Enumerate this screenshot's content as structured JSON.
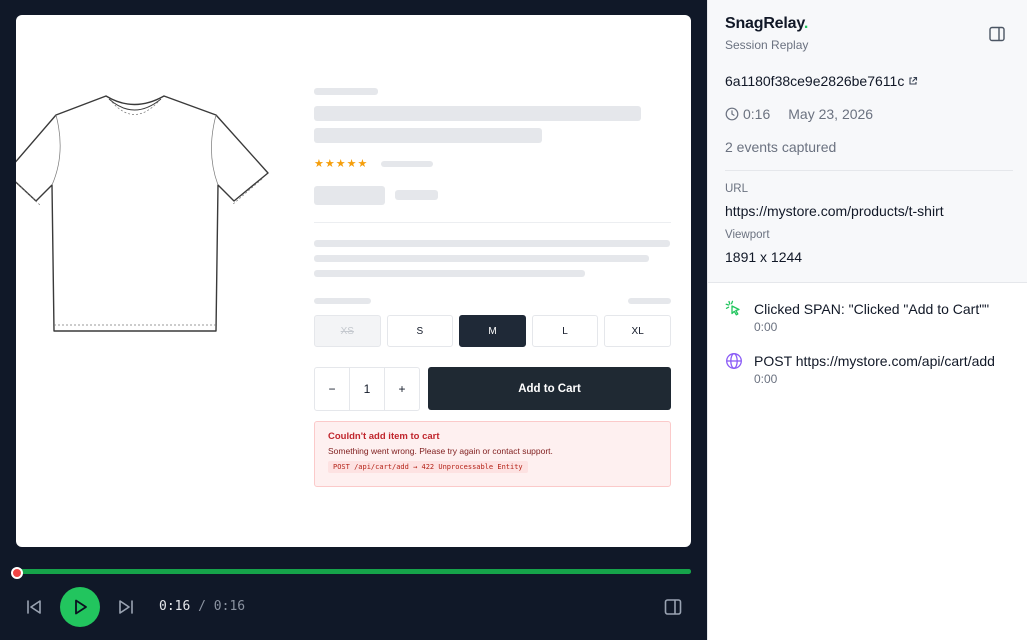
{
  "product_page": {
    "sizes": [
      {
        "label": "XS",
        "state": "disabled"
      },
      {
        "label": "S",
        "state": "normal"
      },
      {
        "label": "M",
        "state": "selected"
      },
      {
        "label": "L",
        "state": "normal"
      },
      {
        "label": "XL",
        "state": "normal"
      }
    ],
    "rating_stars": "★★★★★",
    "quantity": {
      "minus": "−",
      "value": "1",
      "plus": "+"
    },
    "add_to_cart_label": "Add to Cart",
    "error": {
      "title": "Couldn't add item to cart",
      "message": "Something went wrong. Please try again or contact support.",
      "code": "POST /api/cart/add → 422 Unprocessable Entity"
    }
  },
  "player": {
    "current_time": "0:16",
    "separator": "/",
    "total_time": "0:16",
    "progress_fraction": 1.0
  },
  "sidebar": {
    "brand": "SnagRelay",
    "brand_dot": ".",
    "subtitle": "Session Replay",
    "session_id": "6a1180f38ce9e2826be7611c",
    "duration": "0:16",
    "date": "May 23, 2026",
    "events_count": "2 events captured",
    "url_label": "URL",
    "url_value": "https://mystore.com/products/t-shirt",
    "viewport_label": "Viewport",
    "viewport_value": "1891 x 1244",
    "events": [
      {
        "type": "click",
        "icon": "cursor-click-icon",
        "title": "Clicked SPAN: \"Clicked \"Add to Cart\"\"",
        "time": "0:00"
      },
      {
        "type": "network",
        "icon": "globe-icon",
        "title": "POST https://mystore.com/api/cart/add",
        "time": "0:00"
      }
    ]
  },
  "colors": {
    "accent_green": "#22c55e",
    "player_bg": "#101828",
    "error_red": "#c0262d",
    "star_orange": "#f59e0b"
  }
}
